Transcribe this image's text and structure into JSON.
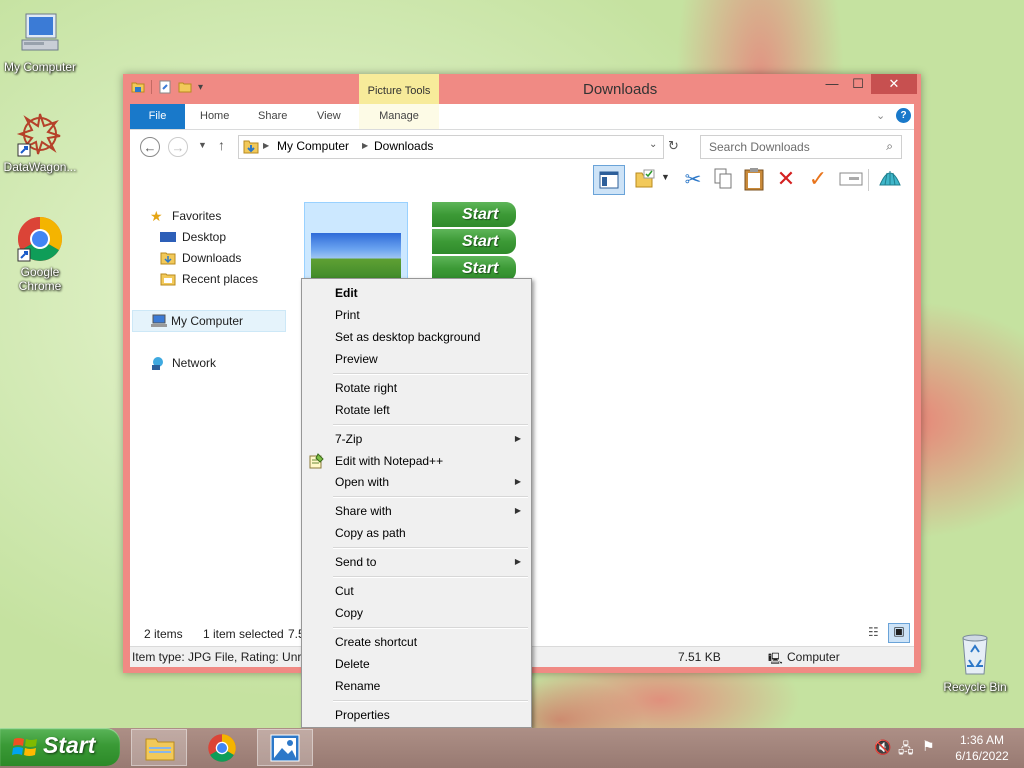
{
  "desktop": {
    "icons": [
      {
        "label": "My Computer"
      },
      {
        "label": "DataWagon..."
      },
      {
        "label": "Google Chrome"
      },
      {
        "label": "Recycle Bin"
      }
    ]
  },
  "window": {
    "title": "Downloads",
    "context_tab_header": "Picture Tools",
    "tabs": [
      {
        "label": "File"
      },
      {
        "label": "Home"
      },
      {
        "label": "Share"
      },
      {
        "label": "View"
      },
      {
        "label": "Manage"
      }
    ],
    "address": {
      "crumbs": [
        "My Computer",
        "Downloads"
      ]
    },
    "search": {
      "placeholder": "Search Downloads"
    },
    "nav_pane": {
      "favorites": "Favorites",
      "items": [
        "Desktop",
        "Downloads",
        "Recent places"
      ],
      "computer": "My Computer",
      "network": "Network"
    },
    "files": {
      "start_button_text": "Start"
    },
    "status": {
      "items": "2 items",
      "selected": "1 item selected",
      "selected_size_partial": "7.5"
    },
    "details": {
      "item_type": "Item type: JPG File, Rating: Unrat",
      "size": "7.51 KB",
      "location": "Computer"
    }
  },
  "context_menu": {
    "groups": [
      [
        {
          "label": "Edit",
          "bold": true
        },
        {
          "label": "Print"
        },
        {
          "label": "Set as desktop background"
        },
        {
          "label": "Preview"
        }
      ],
      [
        {
          "label": "Rotate right"
        },
        {
          "label": "Rotate left"
        }
      ],
      [
        {
          "label": "7-Zip",
          "submenu": true
        },
        {
          "label": "Edit with Notepad++",
          "icon": "notepad-plus-plus-icon"
        },
        {
          "label": "Open with",
          "submenu": true
        }
      ],
      [
        {
          "label": "Share with",
          "submenu": true
        },
        {
          "label": "Copy as path"
        }
      ],
      [
        {
          "label": "Send to",
          "submenu": true
        }
      ],
      [
        {
          "label": "Cut"
        },
        {
          "label": "Copy"
        }
      ],
      [
        {
          "label": "Create shortcut"
        },
        {
          "label": "Delete"
        },
        {
          "label": "Rename"
        }
      ],
      [
        {
          "label": "Properties"
        }
      ]
    ]
  },
  "taskbar": {
    "start_label": "Start",
    "clock": {
      "time": "1:36 AM",
      "date": "6/16/2022"
    }
  }
}
